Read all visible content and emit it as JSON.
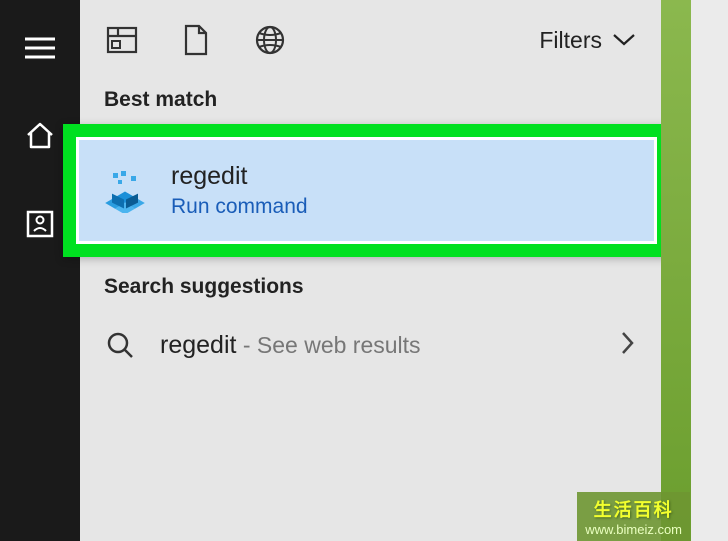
{
  "sidebar": {
    "items": [
      {
        "name": "hamburger"
      },
      {
        "name": "home"
      },
      {
        "name": "user"
      }
    ]
  },
  "topbar": {
    "icons": [
      {
        "name": "newspaper"
      },
      {
        "name": "document"
      },
      {
        "name": "globe"
      }
    ],
    "filters_label": "Filters"
  },
  "sections": {
    "best_match_header": "Best match",
    "search_suggestions_header": "Search suggestions"
  },
  "best_match": {
    "title": "regedit",
    "subtitle": "Run command"
  },
  "suggestion": {
    "query": "regedit",
    "rest": " - See web results"
  },
  "watermark": {
    "title": "生活百科",
    "url": "www.bimeiz.com"
  }
}
